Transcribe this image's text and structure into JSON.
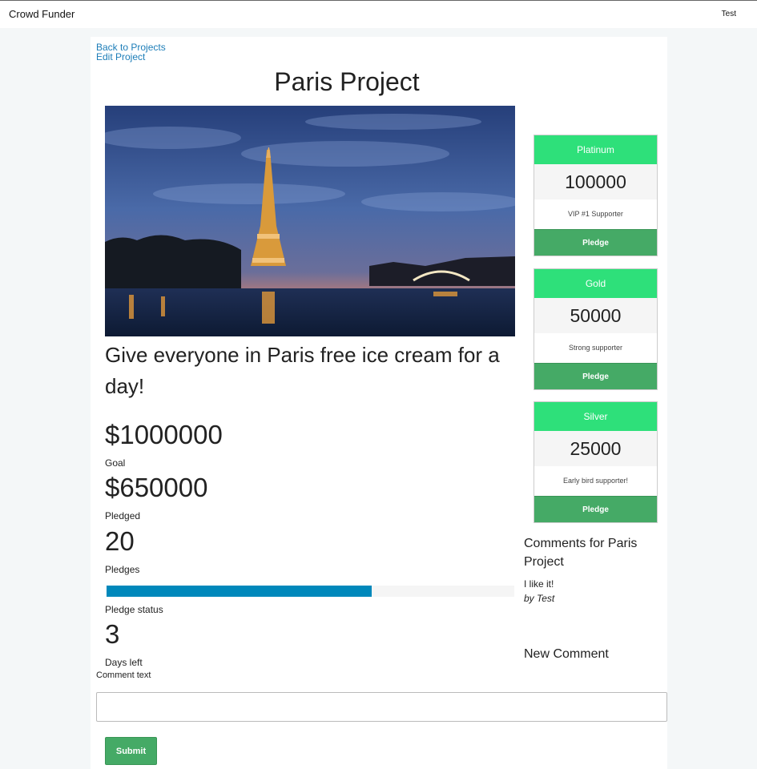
{
  "header": {
    "brand": "Crowd Funder",
    "user": "Test"
  },
  "nav": {
    "back": "Back to Projects",
    "edit": "Edit Project"
  },
  "project": {
    "title": "Paris Project",
    "tagline": "Give everyone in Paris free ice cream for a day!",
    "goal": "$1000000",
    "goal_label": "Goal",
    "pledged": "$650000",
    "pledged_label": "Pledged",
    "pledges": "20",
    "pledges_label": "Pledges",
    "pledge_status_fraction": 0.65,
    "pledge_status_label": "Pledge status",
    "days_left": "3",
    "days_left_label": "Days left"
  },
  "rewards": [
    {
      "tier": "Platinum",
      "amount": "100000",
      "description": "VIP #1 Supporter",
      "button": "Pledge"
    },
    {
      "tier": "Gold",
      "amount": "50000",
      "description": "Strong supporter",
      "button": "Pledge"
    },
    {
      "tier": "Silver",
      "amount": "25000",
      "description": "Early bird supporter!",
      "button": "Pledge"
    }
  ],
  "comments": {
    "title": "Comments for Paris Project",
    "items": [
      {
        "text": "I like it!",
        "author": "by Test"
      }
    ],
    "new_title": "New Comment",
    "field_label": "Comment text",
    "input_value": "",
    "submit": "Submit"
  },
  "colors": {
    "accent_link": "#1c7db8",
    "tier_header": "#2ee07a",
    "button_green": "#45aa66",
    "progress_fill": "#0088bb"
  }
}
